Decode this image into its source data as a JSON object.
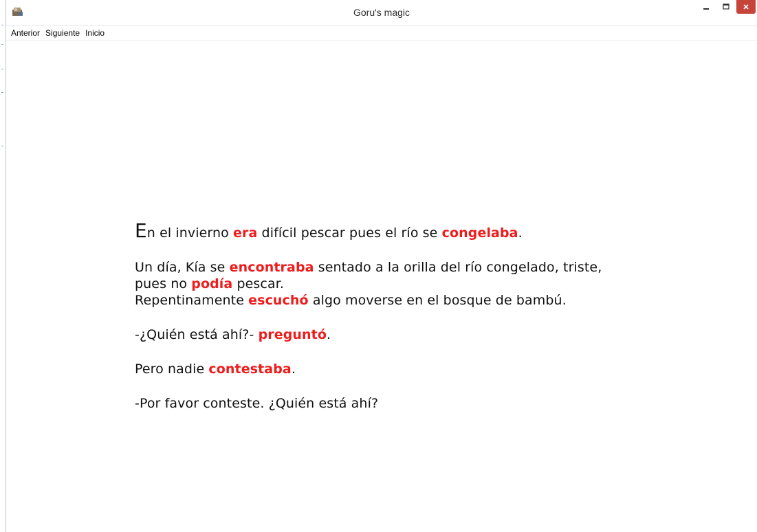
{
  "window": {
    "title": "Goru's magic",
    "close_color": "#c7443b"
  },
  "menu": {
    "items": [
      "Anterior",
      "Siguiente",
      "Inicio"
    ]
  },
  "story": {
    "highlight_color": "#ee1c1c",
    "p1": {
      "cap": "E",
      "t1": "n el invierno ",
      "v1": "era",
      "t2": " difícil pescar pues el río se ",
      "v2": "congelaba",
      "t3": "."
    },
    "p2": {
      "l1a": "Un día, Kía se ",
      "l1v": "encontraba",
      "l1b": " sentado a la orilla del río congelado, triste,",
      "l2a": "pues no ",
      "l2v": "podía",
      "l2b": " pescar.",
      "l3a": "Repentinamente ",
      "l3v": "escuchó",
      "l3b": " algo moverse en el bosque de bambú."
    },
    "p3": {
      "a": "-¿Quién está ahí?- ",
      "v": "preguntó",
      "b": "."
    },
    "p4": {
      "a": "Pero nadie ",
      "v": "contestaba",
      "b": "."
    },
    "p5": {
      "a": "-Por favor conteste. ¿Quién está ahí?"
    }
  }
}
